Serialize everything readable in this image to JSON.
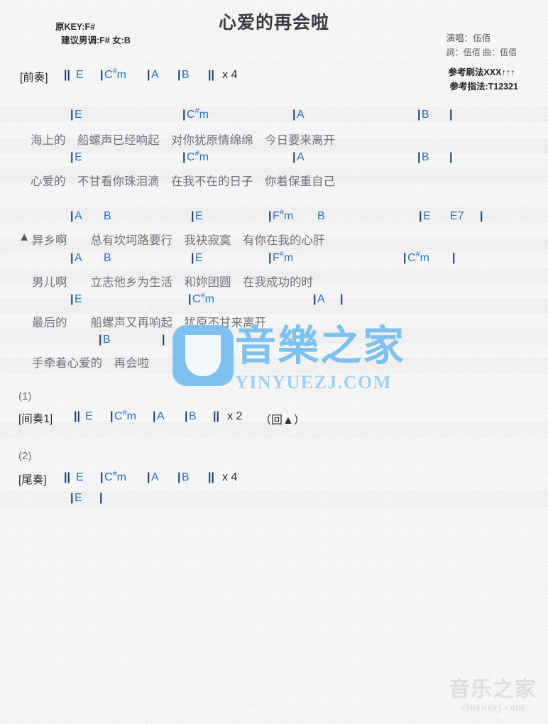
{
  "header": {
    "title": "心爱的再会啦",
    "original_key": "原KEY:F#",
    "suggested_key": "建议男调:F# 女:B",
    "singer": "演唱：伍佰",
    "writers": "詞：伍佰  曲：伍佰",
    "strum_pattern": "参考刷法XXX↑↑↑",
    "finger_pattern": "参考指法:T12321"
  },
  "intro": {
    "label": "[前奏]",
    "open_bar": "||",
    "chords": [
      "E",
      "C#m",
      "A",
      "B"
    ],
    "close_bar": "||",
    "repeat": "x 4"
  },
  "verse1": {
    "line1": {
      "chords": [
        "E",
        "C#m",
        "A",
        "B"
      ],
      "lyric": "海上的　船螺声已经响起　对你犹原情绵绵　今日要来离开"
    },
    "line2": {
      "chords": [
        "E",
        "C#m",
        "A",
        "B"
      ],
      "lyric": "心爱的　不甘看你珠泪滴　在我不在的日子　你着保重自己"
    }
  },
  "chorus": {
    "marker": "▲",
    "line1": {
      "chords": [
        "A",
        "B",
        "E",
        "F#m",
        "B",
        "E",
        "E7"
      ],
      "lyric": "异乡啊　　总有坎坷路要行　我袂寂寞　有你在我的心肝"
    },
    "line2": {
      "chords": [
        "A",
        "B",
        "E",
        "F#m",
        "C#m"
      ],
      "lyric": "男儿啊　　立志他乡为生活　和妳团圆　在我成功的时"
    },
    "line3": {
      "chords": [
        "E",
        "C#m",
        "A"
      ],
      "lyric": "最后的　　船螺声又再响起　犹原不甘来离开"
    },
    "line4": {
      "chords": [
        "B"
      ],
      "lyric": "手牵着心爱的　再会啦"
    }
  },
  "ending1": {
    "number": "(1)",
    "label": "[间奏1]",
    "open_bar": "||",
    "chords": [
      "E",
      "C#m",
      "A",
      "B"
    ],
    "close_bar": "||",
    "repeat": "x 2",
    "note": "（回▲）"
  },
  "ending2": {
    "number": "(2)",
    "label": "[尾奏]",
    "open_bar": "||",
    "chords": [
      "E",
      "C#m",
      "A",
      "B"
    ],
    "close_bar": "||",
    "repeat": "x 4",
    "final_chord": "E"
  },
  "watermark_center": {
    "hanzi": "音樂之家",
    "latin": "YINYUEZJ.COM"
  },
  "watermark_corner": {
    "hanzi": "音乐之家",
    "latin": "yinyuezj.com"
  },
  "colors": {
    "chord": "#2670c0",
    "lyric": "#70707a",
    "bar": "#1b3f6b",
    "watermark_blue": "#7ec1ee"
  }
}
